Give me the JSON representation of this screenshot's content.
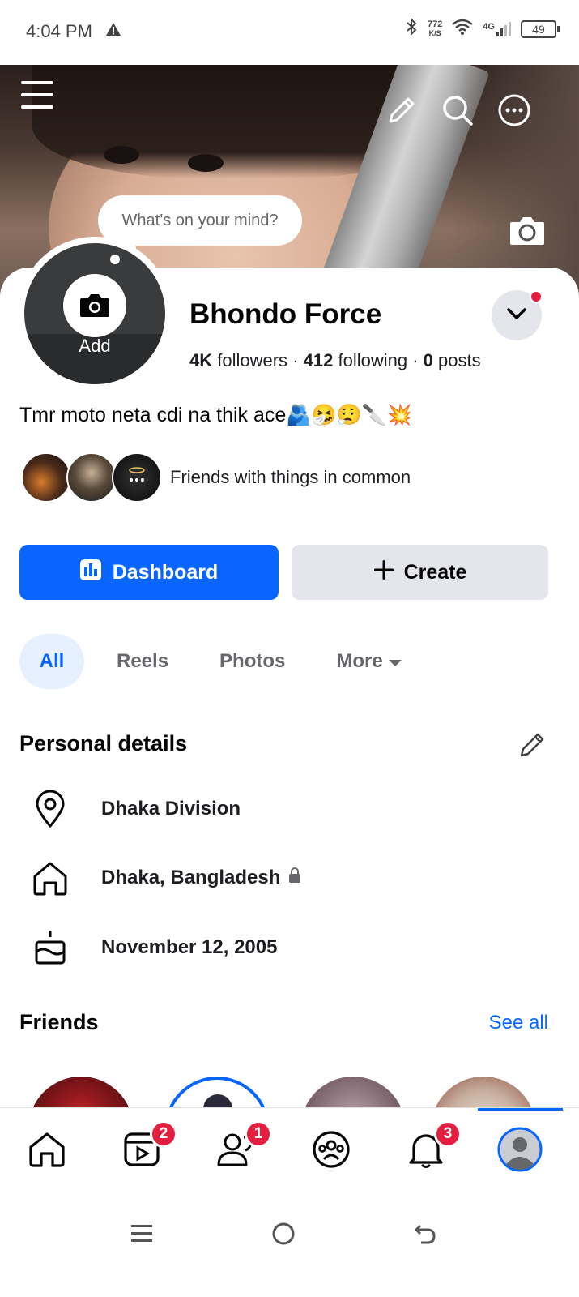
{
  "status_bar": {
    "time": "4:04 PM",
    "net_speed_value": "772",
    "net_speed_unit": "K/S",
    "network": "4G",
    "battery": "49"
  },
  "cover": {
    "mind_prompt": "What’s on your mind?"
  },
  "profile": {
    "avatar_add_label": "Add",
    "name": "Bhondo Force",
    "followers_count": "4K",
    "followers_label": "followers",
    "following_count": "412",
    "following_label": "following",
    "posts_count": "0",
    "posts_label": "posts",
    "separator": "·",
    "bio_text": "Tmr moto neta cdi na thik ace",
    "bio_emojis": "🫂🤧😮‍💨🔪💥",
    "mutuals_text": "Friends with things in common"
  },
  "actions": {
    "dashboard_label": "Dashboard",
    "create_label": "Create"
  },
  "tabs": [
    {
      "label": "All",
      "active": true
    },
    {
      "label": "Reels",
      "active": false
    },
    {
      "label": "Photos",
      "active": false
    },
    {
      "label": "More",
      "active": false
    }
  ],
  "personal_details": {
    "title": "Personal details",
    "items": [
      {
        "icon": "location-pin-icon",
        "text": "Dhaka Division"
      },
      {
        "icon": "home-icon",
        "text": "Dhaka, Bangladesh"
      },
      {
        "icon": "birthday-cake-icon",
        "text": "November 12, 2005"
      }
    ]
  },
  "friends": {
    "title": "Friends",
    "see_all": "See all"
  },
  "bottom_nav": {
    "reels_badge": "2",
    "friends_badge": "1",
    "notifications_badge": "3"
  },
  "colors": {
    "accent": "#0866ff",
    "badge": "#e41e3f",
    "secondary_button": "#e4e6eb"
  }
}
